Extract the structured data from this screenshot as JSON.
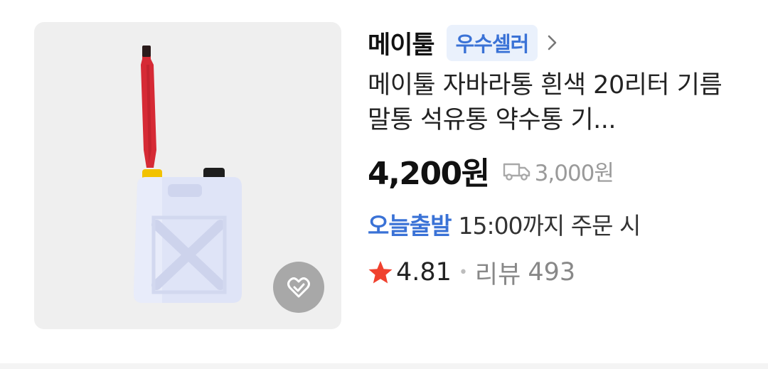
{
  "product": {
    "image_alt": "white plastic jerry can with red spout",
    "seller": {
      "name": "메이툴",
      "badge": "우수셀러",
      "chevron_icon": "chevron-right-icon"
    },
    "title": "메이툴 자바라통 흰색 20리터 기름 말통 석유통 약수통 기...",
    "price": "4,200원",
    "shipping": {
      "icon": "truck-icon",
      "fee": "3,000원"
    },
    "delivery": {
      "tag": "오늘출발",
      "text": "15:00까지 주문 시"
    },
    "rating": {
      "star_icon": "star-icon",
      "value": "4.81",
      "separator": "•",
      "review_label": "리뷰",
      "review_count": "493"
    },
    "wishlist_icon": "heart-check-icon"
  },
  "colors": {
    "accent_blue": "#3a72d6",
    "badge_bg": "#eaf1fc",
    "star_red": "#f0412e",
    "thumb_bg": "#efefef"
  }
}
